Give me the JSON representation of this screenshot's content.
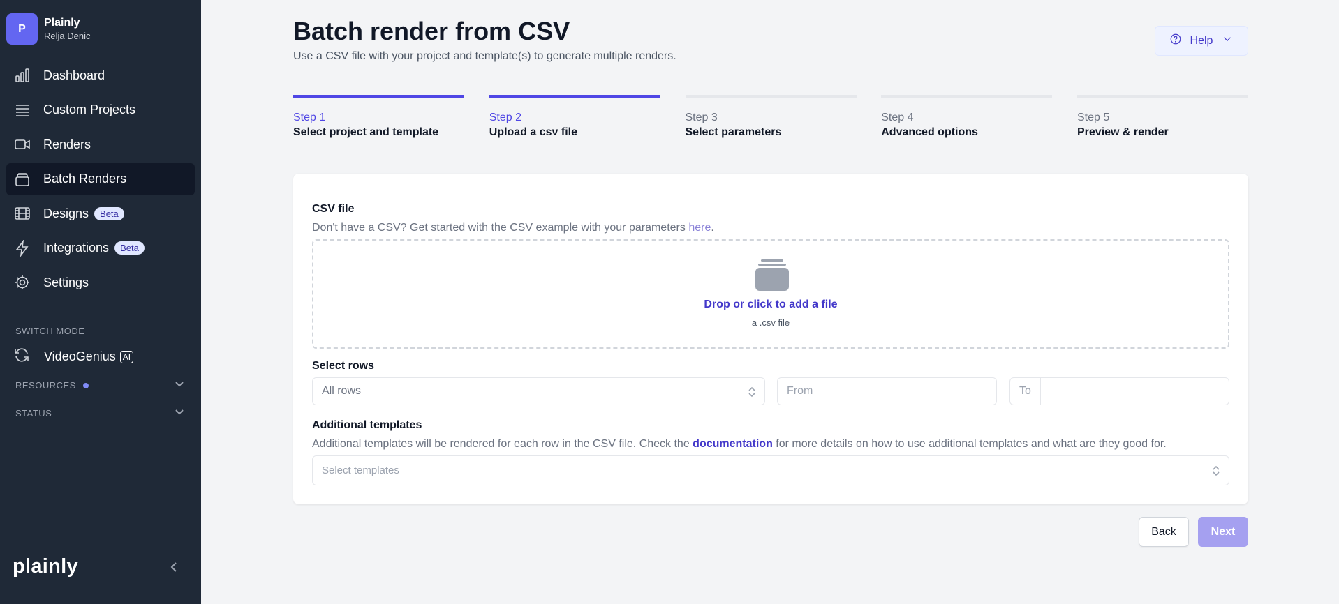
{
  "account": {
    "avatar_letter": "P",
    "org": "Plainly",
    "user": "Relja Denic"
  },
  "nav": {
    "items": [
      {
        "label": "Dashboard",
        "icon": "bar-chart-icon"
      },
      {
        "label": "Custom Projects",
        "icon": "layers-icon"
      },
      {
        "label": "Renders",
        "icon": "video-camera-icon"
      },
      {
        "label": "Batch Renders",
        "icon": "stack-icon",
        "active": true
      },
      {
        "label": "Designs",
        "icon": "film-icon",
        "badge": "Beta"
      },
      {
        "label": "Integrations",
        "icon": "bolt-icon",
        "badge": "Beta"
      },
      {
        "label": "Settings",
        "icon": "gear-icon"
      }
    ]
  },
  "switch_mode": {
    "title": "SWITCH MODE",
    "item_label": "VideoGenius",
    "ai_tag": "AI"
  },
  "resources": {
    "title": "RESOURCES"
  },
  "status": {
    "title": "STATUS"
  },
  "brand": {
    "logo_text": "plainly"
  },
  "header": {
    "title": "Batch render from CSV",
    "subtitle": "Use a CSV file with your project and template(s) to generate multiple renders.",
    "help_label": "Help"
  },
  "steps": [
    {
      "num": "Step 1",
      "name": "Select project and template",
      "done": true
    },
    {
      "num": "Step 2",
      "name": "Upload a csv file",
      "done": true
    },
    {
      "num": "Step 3",
      "name": "Select parameters",
      "done": false
    },
    {
      "num": "Step 4",
      "name": "Advanced options",
      "done": false
    },
    {
      "num": "Step 5",
      "name": "Preview & render",
      "done": false
    }
  ],
  "csv": {
    "label": "CSV file",
    "help_prefix": "Don't have a CSV? Get started with the CSV example with your parameters ",
    "help_link": "here",
    "help_suffix": ".",
    "drop_title": "Drop or click to add a file",
    "drop_sub": "a .csv file"
  },
  "rows": {
    "label": "Select rows",
    "select_value": "All rows",
    "from_label": "From",
    "to_label": "To",
    "from_value": "",
    "to_value": ""
  },
  "templates": {
    "label": "Additional templates",
    "help_prefix": "Additional templates will be rendered for each row in the CSV file. Check the ",
    "help_link": "documentation",
    "help_suffix": " for more details on how to use additional templates and what are they good for.",
    "placeholder": "Select templates"
  },
  "actions": {
    "back": "Back",
    "next": "Next"
  },
  "colors": {
    "sidebar_bg": "#1f2937",
    "accent": "#4f46e5",
    "next_disabled": "#a5a0f0"
  }
}
